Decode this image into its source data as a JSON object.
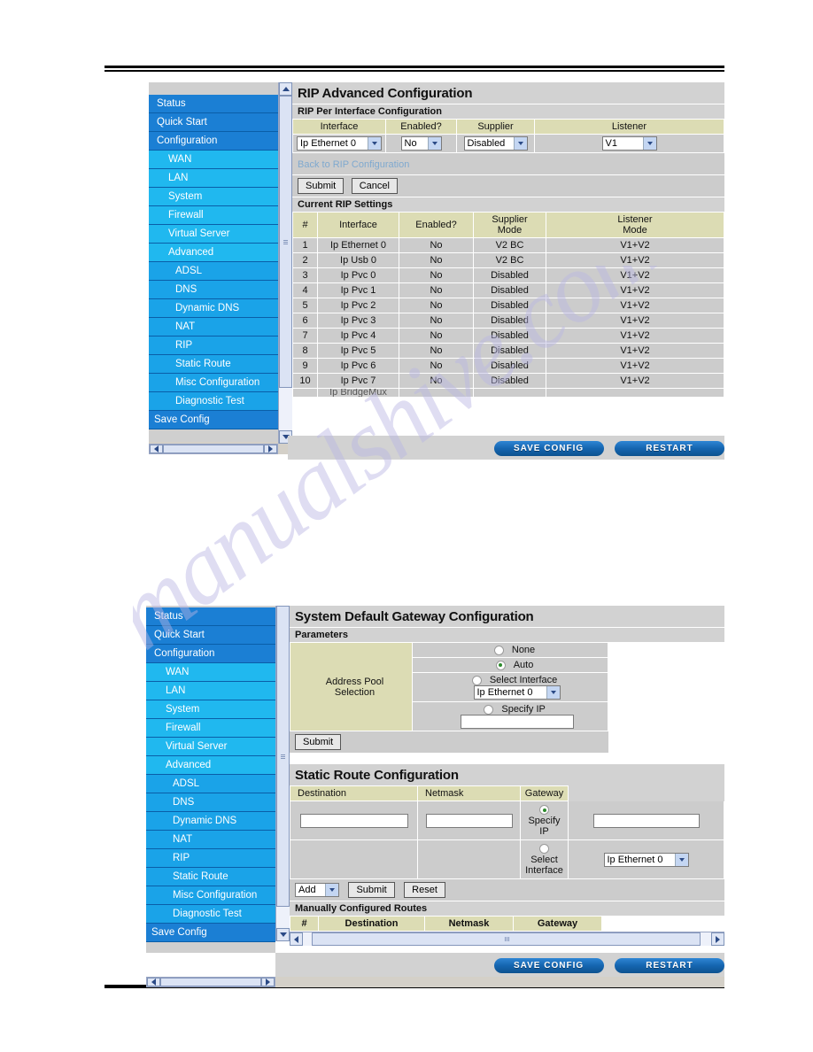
{
  "document": {
    "watermark": "manualshive.com"
  },
  "nav": {
    "items": [
      {
        "label": "Status",
        "level": 0
      },
      {
        "label": "Quick Start",
        "level": 0
      },
      {
        "label": "Configuration",
        "level": 0
      },
      {
        "label": "WAN",
        "level": 1
      },
      {
        "label": "LAN",
        "level": 1
      },
      {
        "label": "System",
        "level": 1
      },
      {
        "label": "Firewall",
        "level": 1
      },
      {
        "label": "Virtual Server",
        "level": 1
      },
      {
        "label": "Advanced",
        "level": 1
      },
      {
        "label": "ADSL",
        "level": 2
      },
      {
        "label": "DNS",
        "level": 2
      },
      {
        "label": "Dynamic DNS",
        "level": 2
      },
      {
        "label": "NAT",
        "level": 2
      },
      {
        "label": "RIP",
        "level": 2
      },
      {
        "label": "Static Route",
        "level": 2
      },
      {
        "label": "Misc Configuration",
        "level": 2
      },
      {
        "label": "Diagnostic Test",
        "level": 2
      },
      {
        "label": "Save Config",
        "level": 3
      }
    ]
  },
  "panel1": {
    "title": "RIP Advanced Configuration",
    "per_interface_heading": "RIP Per Interface Configuration",
    "form_headers": [
      "Interface",
      "Enabled?",
      "Supplier",
      "Listener"
    ],
    "form_values": {
      "interface": "Ip Ethernet 0",
      "enabled": "No",
      "supplier": "Disabled",
      "listener": "V1"
    },
    "back_link": "Back to RIP Configuration",
    "submit_label": "Submit",
    "cancel_label": "Cancel",
    "current_heading": "Current RIP Settings",
    "table_headers": [
      "#",
      "Interface",
      "Enabled?",
      "Supplier Mode",
      "Listener Mode"
    ],
    "table_header_supplier_l1": "Supplier",
    "table_header_supplier_l2": "Mode",
    "table_header_listener_l1": "Listener",
    "table_header_listener_l2": "Mode",
    "rows": [
      {
        "num": "1",
        "interface": "Ip Ethernet 0",
        "enabled": "No",
        "supplier": "V2 BC",
        "listener": "V1+V2"
      },
      {
        "num": "2",
        "interface": "Ip Usb 0",
        "enabled": "No",
        "supplier": "V2 BC",
        "listener": "V1+V2"
      },
      {
        "num": "3",
        "interface": "Ip Pvc 0",
        "enabled": "No",
        "supplier": "Disabled",
        "listener": "V1+V2"
      },
      {
        "num": "4",
        "interface": "Ip Pvc 1",
        "enabled": "No",
        "supplier": "Disabled",
        "listener": "V1+V2"
      },
      {
        "num": "5",
        "interface": "Ip Pvc 2",
        "enabled": "No",
        "supplier": "Disabled",
        "listener": "V1+V2"
      },
      {
        "num": "6",
        "interface": "Ip Pvc 3",
        "enabled": "No",
        "supplier": "Disabled",
        "listener": "V1+V2"
      },
      {
        "num": "7",
        "interface": "Ip Pvc 4",
        "enabled": "No",
        "supplier": "Disabled",
        "listener": "V1+V2"
      },
      {
        "num": "8",
        "interface": "Ip Pvc 5",
        "enabled": "No",
        "supplier": "Disabled",
        "listener": "V1+V2"
      },
      {
        "num": "9",
        "interface": "Ip Pvc 6",
        "enabled": "No",
        "supplier": "Disabled",
        "listener": "V1+V2"
      },
      {
        "num": "10",
        "interface": "Ip Pvc 7",
        "enabled": "No",
        "supplier": "Disabled",
        "listener": "V1+V2"
      },
      {
        "num": "",
        "interface": "Ip BridgeMux",
        "enabled": "",
        "supplier": "",
        "listener": ""
      }
    ],
    "save_config_label": "SAVE CONFIG",
    "restart_label": "RESTART"
  },
  "panel2": {
    "title": "System Default Gateway Configuration",
    "parameters_heading": "Parameters",
    "address_pool_label_l1": "Address Pool",
    "address_pool_label_l2": "Selection",
    "options": [
      {
        "label": "None",
        "selected": false
      },
      {
        "label": "Auto",
        "selected": true
      },
      {
        "label": "Select Interface",
        "selected": false
      },
      {
        "label": "Specify IP",
        "selected": false
      }
    ],
    "select_interface_value": "Ip Ethernet 0",
    "specify_ip_value": "",
    "submit_label": "Submit",
    "static_route_title": "Static Route Configuration",
    "static_route_headers": [
      "Destination",
      "Netmask",
      "Gateway",
      ""
    ],
    "destination_value": "",
    "netmask_value": "",
    "gateway_specify_ip_l1": "Specify",
    "gateway_specify_ip_l2": "IP",
    "gateway_specify_ip_value": "",
    "gateway_select_interface_l1": "Select",
    "gateway_select_interface_l2": "Interface",
    "gateway_interface_value": "Ip Ethernet 0",
    "action_select_value": "Add",
    "submit2_label": "Submit",
    "reset_label": "Reset",
    "manual_routes_heading": "Manually Configured Routes",
    "manual_routes_headers": [
      "#",
      "Destination",
      "Netmask",
      "Gateway"
    ],
    "save_config_label": "SAVE CONFIG",
    "restart_label": "RESTART"
  }
}
